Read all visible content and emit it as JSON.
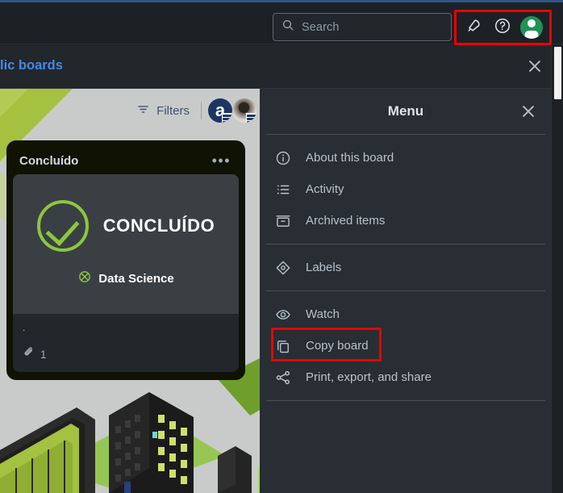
{
  "window": {
    "accent_blue": "#2f5686",
    "bg_dark": "#1d2125",
    "highlight_color": "#ee0000"
  },
  "topbar": {
    "search": {
      "icon": "search-icon",
      "value": "",
      "placeholder": "Search"
    },
    "actions": [
      {
        "icon": "notification-bell-icon",
        "label": "Notifications"
      },
      {
        "icon": "help-circle-icon",
        "label": "Help"
      },
      {
        "icon": "account-avatar-icon",
        "label": "Account"
      }
    ]
  },
  "banner": {
    "link_text": "lic boards",
    "close_icon": "close-icon"
  },
  "board": {
    "toolbar": {
      "filters_label": "Filters",
      "filters_icon": "filter-icon",
      "members": [
        {
          "type": "initial",
          "initial": "a",
          "badge": "premium-badge-icon"
        },
        {
          "type": "photo",
          "initial": "",
          "badge": "premium-badge-icon"
        }
      ]
    },
    "list": {
      "title": "Concluído",
      "menu_icon": "list-actions-dots-icon",
      "card": {
        "cover": {
          "check_icon": "check-circle-icon",
          "title": "CONCLUÍDO",
          "sub_icon": "atom-icon",
          "sub_title": "Data Science"
        },
        "title": ".",
        "attachment_icon": "paperclip-icon",
        "attachment_count": "1"
      }
    }
  },
  "menu": {
    "title": "Menu",
    "close_icon": "close-icon",
    "groups": [
      {
        "items": [
          {
            "icon": "info-circle-icon",
            "label": "About this board"
          },
          {
            "icon": "activity-list-icon",
            "label": "Activity"
          },
          {
            "icon": "archive-box-icon",
            "label": "Archived items"
          }
        ]
      },
      {
        "items": [
          {
            "icon": "label-tag-icon",
            "label": "Labels"
          }
        ]
      },
      {
        "items": [
          {
            "icon": "eye-watch-icon",
            "label": "Watch"
          },
          {
            "icon": "copy-board-icon",
            "label": "Copy board"
          },
          {
            "icon": "share-nodes-icon",
            "label": "Print, export, and share"
          }
        ]
      }
    ]
  },
  "annotations": [
    {
      "name": "topbar-icons-highlight",
      "target": "topbar.actions"
    },
    {
      "name": "copy-board-highlight",
      "target": "menu.groups.2.items.1"
    }
  ]
}
